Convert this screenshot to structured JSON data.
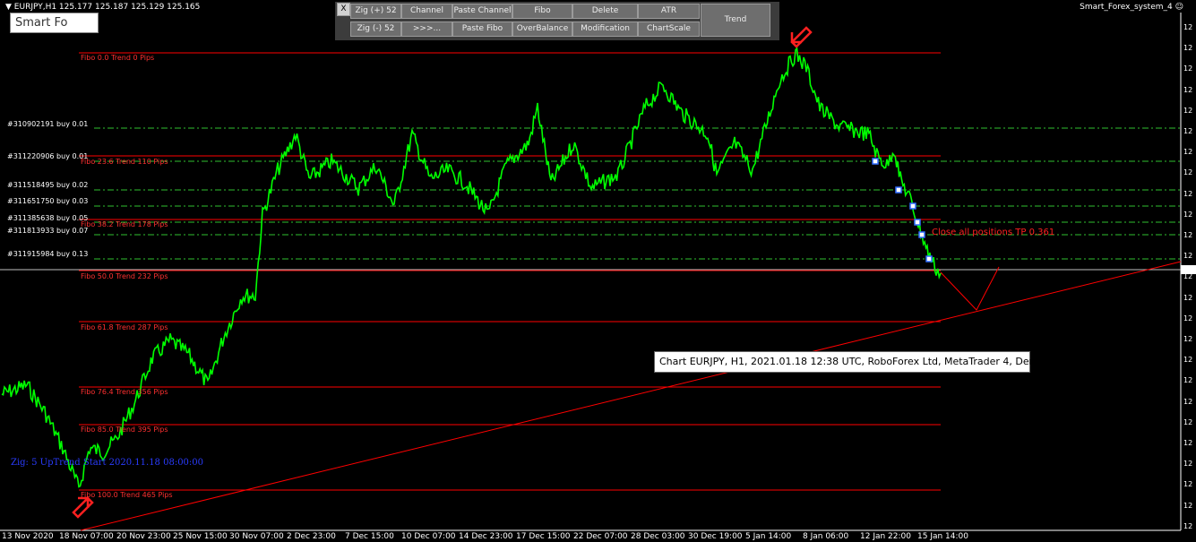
{
  "header": {
    "symbol_line": "EURJPY,H1  125.177 125.187 125.129 125.165",
    "indicator_name": "Smart_Forex_system_4",
    "smart_box_label": "Smart Fo"
  },
  "toolbar": {
    "close_label": "X",
    "row1": [
      "Zig (+) 52",
      "Channel",
      "Paste Channel",
      "Fibo",
      "Delete",
      "ATR"
    ],
    "row2": [
      "Zig (-) 52",
      ">>>...",
      "Paste Fibo",
      "OverBalance",
      "Modification",
      "ChartScale"
    ],
    "trend_label": "Trend"
  },
  "fibo_labels": [
    "Fibo 0.0 Trend 0 Pips",
    "Fibo 23.6 Trend 110 Pips",
    "Fibo 38.2 Trend 178 Pips",
    "Fibo 50.0 Trend 232 Pips",
    "Fibo 61.8 Trend 287 Pips",
    "Fibo 76.4 Trend 356 Pips",
    "Fibo 85.0 Trend 395 Pips",
    "Fibo 100.0 Trend 465 Pips"
  ],
  "orders": [
    "#310902191 buy 0.01",
    "#311220906 buy 0.01",
    "#311518495 buy 0.02",
    "#311651750 buy 0.03",
    "#311385638 buy 0.05",
    "#311813933 buy 0.07",
    "#311915984 buy 0.13"
  ],
  "zig_text": "Zig: 5 UpTrend  Start  2020.11.18 08:00:00",
  "close_text": "Close all positions TP 0.361",
  "tooltip": "Chart EURJPY, H1, 2021.01.18 12:38 UTC, RoboForex Ltd, MetaTrader 4, Demo",
  "x_axis": [
    "13 Nov 2020",
    "18 Nov 07:00",
    "20 Nov 23:00",
    "25 Nov 15:00",
    "30 Nov 07:00",
    "2 Dec 23:00",
    "7 Dec 15:00",
    "10 Dec 07:00",
    "14 Dec 23:00",
    "17 Dec 15:00",
    "22 Dec 07:00",
    "28 Dec 03:00",
    "30 Dec 19:00",
    "5 Jan 14:00",
    "8 Jan 06:00",
    "12 Jan 22:00",
    "15 Jan 14:00"
  ],
  "y_axis_tick": "12",
  "colors": {
    "price": "#00ff00",
    "fibo": "#ff0000",
    "order_line": "#00c000",
    "zig_text": "#0000ff",
    "arrow": "#ff2020"
  },
  "icons": [
    "down-arrow-icon",
    "up-arrow-icon",
    "dropdown-triangle-icon",
    "smiley-icon"
  ]
}
